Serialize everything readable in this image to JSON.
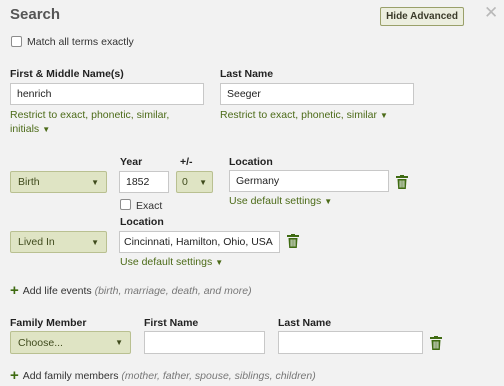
{
  "header": {
    "title": "Search",
    "hide_advanced_label": "Hide Advanced",
    "close_glyph": "✕"
  },
  "match_exact_label": "Match all terms exactly",
  "name": {
    "first_label": "First & Middle Name(s)",
    "first_value": "henrich",
    "first_restrict": "Restrict to exact, phonetic, similar,",
    "first_restrict_cont": "initials",
    "last_label": "Last Name",
    "last_value": "Seeger",
    "last_restrict": "Restrict to exact, phonetic, similar"
  },
  "birth_event": {
    "type": "Birth",
    "year_label": "Year",
    "year_value": "1852",
    "range_label": "+/-",
    "range_value": "0",
    "exact_label": "Exact",
    "location_label": "Location",
    "location_value": "Germany",
    "default_settings": "Use default settings"
  },
  "residence_event": {
    "type": "Lived In",
    "location_label": "Location",
    "location_value": "Cincinnati, Hamilton, Ohio, USA",
    "default_settings": "Use default settings"
  },
  "add_life_events": {
    "label": "Add life events",
    "hint": "(birth, marriage, death, and more)"
  },
  "family": {
    "member_label": "Family Member",
    "member_value": "Choose...",
    "first_label": "First Name",
    "last_label": "Last Name"
  },
  "add_family_members": {
    "label": "Add family members",
    "hint": "(mother, father, spouse, siblings, children)"
  },
  "colors": {
    "accent_green": "#4c6b18",
    "select_bg": "#dfe4c4",
    "background": "#f2f2f2"
  },
  "icons": [
    "close-icon",
    "trash-icon",
    "plus-icon",
    "dropdown-caret-icon"
  ]
}
